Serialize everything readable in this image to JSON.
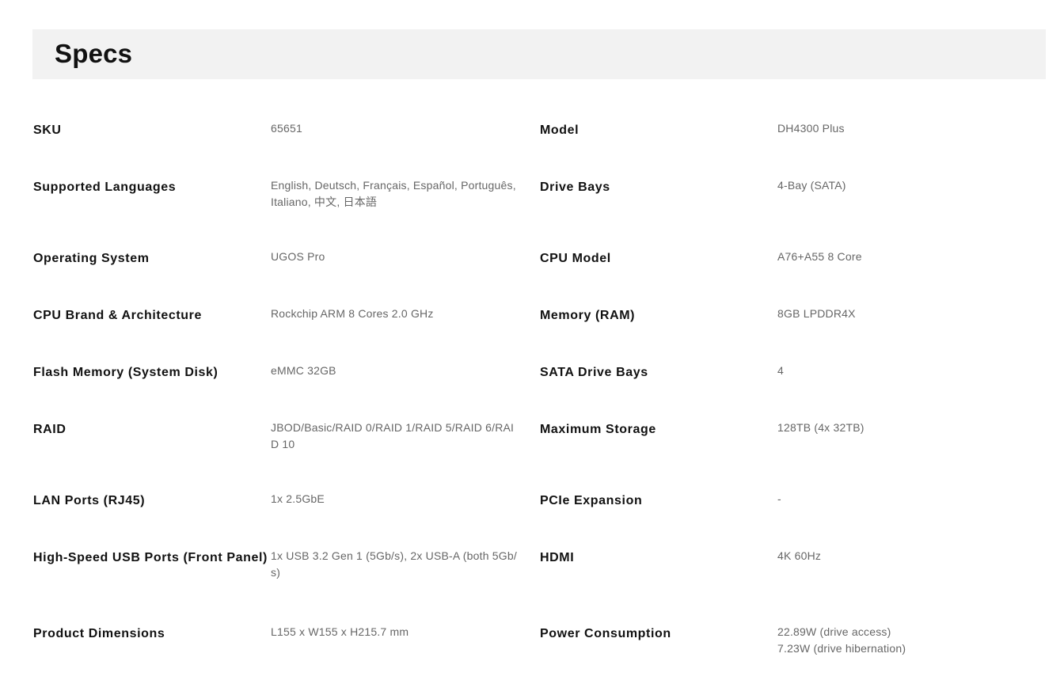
{
  "header": {
    "title": "Specs"
  },
  "specs": [
    {
      "left_label": "SKU",
      "left_value": "65651",
      "right_label": "Model",
      "right_value": "DH4300 Plus"
    },
    {
      "left_label": "Supported Languages",
      "left_value": "English, Deutsch, Français, Español, Português, Italiano, 中文, 日本語",
      "right_label": "Drive Bays",
      "right_value": "4-Bay (SATA)"
    },
    {
      "left_label": "Operating System",
      "left_value": "UGOS Pro",
      "right_label": "CPU Model",
      "right_value": "A76+A55 8 Core"
    },
    {
      "left_label": "CPU Brand & Architecture",
      "left_value": "Rockchip ARM 8 Cores 2.0 GHz",
      "right_label": "Memory (RAM)",
      "right_value": "8GB LPDDR4X"
    },
    {
      "left_label": "Flash Memory (System Disk)",
      "left_value": "eMMC 32GB",
      "right_label": "SATA Drive Bays",
      "right_value": "4"
    },
    {
      "left_label": "RAID",
      "left_value": "JBOD/Basic/RAID 0/RAID 1/RAID 5/RAID 6/RAID 10",
      "right_label": "Maximum Storage",
      "right_value": "128TB (4x 32TB)"
    },
    {
      "left_label": "LAN Ports (RJ45)",
      "left_value": "1x 2.5GbE",
      "right_label": "PCIe Expansion",
      "right_value": "-"
    },
    {
      "left_label": "High-Speed USB Ports (Front Panel)",
      "left_value": "1x USB 3.2 Gen 1 (5Gb/s), 2x USB-A (both 5Gb/s)",
      "right_label": "HDMI",
      "right_value": "4K 60Hz"
    },
    {
      "left_label": "Product Dimensions",
      "left_value": "L155 x W155 x H215.7 mm",
      "right_label": "Power Consumption",
      "right_value": "22.89W (drive access)\n7.23W (drive hibernation)"
    }
  ]
}
